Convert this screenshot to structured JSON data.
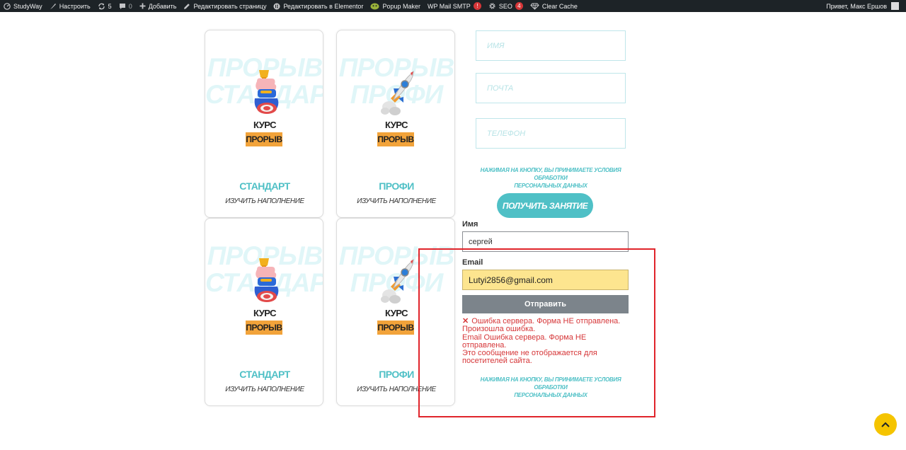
{
  "admin_bar": {
    "site_name": "StudyWay",
    "customize": "Настроить",
    "updates_count": "5",
    "comments_count": "0",
    "new_label": "Добавить",
    "edit_page": "Редактировать страницу",
    "edit_elementor": "Редактировать в Elementor",
    "popup_maker": "Popup Maker",
    "wp_mail_smtp": "WP Mail SMTP",
    "wp_mail_smtp_badge": "!",
    "seo": "SEO",
    "seo_badge": "4",
    "clear_cache": "Clear Cache",
    "greeting": "Привет, Макс Ершов"
  },
  "cards": [
    {
      "bg_line1": "ПРОРЫВ",
      "bg_line2": "СТАНДАРТ",
      "course_label": "КУРС",
      "course_tag": "ПРОРЫВ",
      "title": "СТАНДАРТ",
      "subtitle": "ИЗУЧИТЬ НАПОЛНЕНИЕ",
      "icon": "hand-cup-icon"
    },
    {
      "bg_line1": "ПРОРЫВ",
      "bg_line2": "ПРОФИ",
      "course_label": "КУРС",
      "course_tag": "ПРОРЫВ",
      "title": "ПРОФИ",
      "subtitle": "ИЗУЧИТЬ НАПОЛНЕНИЕ",
      "icon": "rocket-icon"
    },
    {
      "bg_line1": "ПРОРЫВ",
      "bg_line2": "СТАНДАРТ",
      "course_label": "КУРС",
      "course_tag": "ПРОРЫВ",
      "title": "СТАНДАРТ",
      "subtitle": "ИЗУЧИТЬ НАПОЛНЕНИЕ",
      "icon": "hand-cup-icon"
    },
    {
      "bg_line1": "ПРОРЫВ",
      "bg_line2": "ПРОФИ",
      "course_label": "КУРС",
      "course_tag": "ПРОРЫВ",
      "title": "ПРОФИ",
      "subtitle": "ИЗУЧИТЬ НАПОЛНЕНИЕ",
      "icon": "rocket-icon"
    }
  ],
  "lead_form": {
    "name_placeholder": "ИМЯ",
    "email_placeholder": "ПОЧТА",
    "phone_placeholder": "ТЕЛЕФОН",
    "legal_line1": "НАЖИМАЯ НА КНОПКУ, ВЫ ПРИНИМАЕТЕ УСЛОВИЯ ОБРАБОТКИ",
    "legal_line2": "ПЕРСОНАЛЬНЫХ ДАННЫХ",
    "submit": "ПОЛУЧИТЬ ЗАНЯТИЕ"
  },
  "contact_form": {
    "name_label": "Имя",
    "name_value": "сергей",
    "email_label": "Email",
    "email_value": "Lutyi2856@gmail.com",
    "submit": "Отправить",
    "error_line1": "Ошибка сервера. Форма НЕ отправлена.",
    "error_line2": "Произошла ошибка.",
    "error_line3": "Email Ошибка сервера. Форма НЕ",
    "error_line4": "отправлена.",
    "error_line5": "Это сообщение не отображается для",
    "error_line6": "посетителей сайта.",
    "legal_line1": "НАЖИМАЯ НА КНОПКУ, ВЫ ПРИНИМАЕТЕ УСЛОВИЯ ОБРАБОТКИ",
    "legal_line2": "ПЕРСОНАЛЬНЫХ ДАННЫХ"
  },
  "colors": {
    "accent": "#4fc0c6",
    "tag": "#f2a33a",
    "error": "#d63638",
    "highlight": "#e0242b",
    "scroll_button": "#f5c400"
  }
}
